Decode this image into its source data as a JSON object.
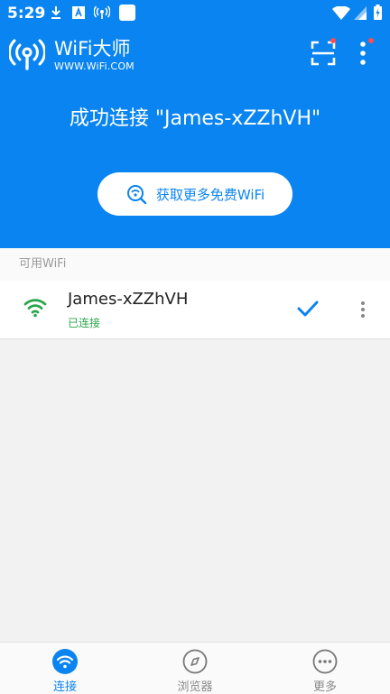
{
  "status_bar": {
    "time": "5:29"
  },
  "app": {
    "title": "WiFi大师",
    "url": "WWW.WiFi.COM"
  },
  "colors": {
    "primary": "#0a84f0",
    "connected_green": "#2aa54b",
    "badge_red": "#ff4d4d"
  },
  "hero": {
    "headline": "成功连接 \"James-xZZhVH\"",
    "button_label": "获取更多免费WiFi"
  },
  "list": {
    "section_title": "可用WiFi",
    "networks": [
      {
        "ssid": "James-xZZhVH",
        "status": "已连接",
        "icon": "wifi-signal-icon",
        "connected": true
      }
    ]
  },
  "bottom_nav": {
    "tabs": [
      {
        "label": "连接",
        "icon": "wifi-icon",
        "active": true
      },
      {
        "label": "浏览器",
        "icon": "compass-icon",
        "active": false
      },
      {
        "label": "更多",
        "icon": "more-icon",
        "active": false
      }
    ]
  }
}
